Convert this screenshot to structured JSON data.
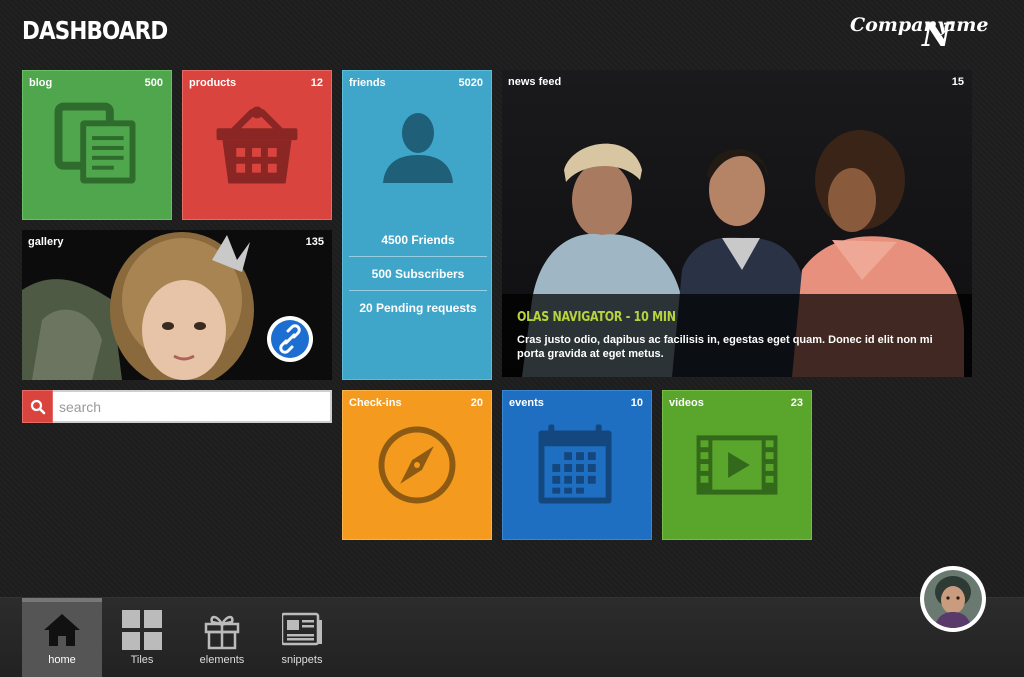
{
  "header": {
    "title": "DASHBOARD",
    "logo_word1": "Company",
    "logo_letter": "N",
    "logo_word2": "ame"
  },
  "tiles": {
    "blog": {
      "label": "blog",
      "count": "500",
      "color": "#4fa64c"
    },
    "products": {
      "label": "products",
      "count": "12",
      "color": "#d9443f"
    },
    "friends": {
      "label": "friends",
      "count": "5020",
      "color": "#3fa6c9",
      "stats": [
        "4500 Friends",
        "500 Subscribers",
        "20 Pending requests"
      ]
    },
    "news_feed": {
      "label": "news feed",
      "count": "15",
      "heading": "OLAS NAVIGATOR - 10 MIN",
      "body": "Cras justo odio, dapibus ac facilisis in, egestas eget quam. Donec id elit non mi porta gravida at eget metus."
    },
    "gallery": {
      "label": "gallery",
      "count": "135"
    },
    "checkins": {
      "label": "Check-ins",
      "count": "20",
      "color": "#f39a1f"
    },
    "events": {
      "label": "events",
      "count": "10",
      "color": "#1e6fc2"
    },
    "videos": {
      "label": "videos",
      "count": "23",
      "color": "#5aa52b"
    }
  },
  "search": {
    "placeholder": "search",
    "value": ""
  },
  "bottom_nav": {
    "home": "home",
    "tiles": "Tiles",
    "elements": "elements",
    "snippets": "snippets"
  },
  "icons": {
    "blog": "documents-icon",
    "products": "basket-icon",
    "friends": "user-icon",
    "checkins": "compass-icon",
    "events": "calendar-icon",
    "videos": "film-icon",
    "gallery_link": "link-icon",
    "search": "search-icon"
  }
}
